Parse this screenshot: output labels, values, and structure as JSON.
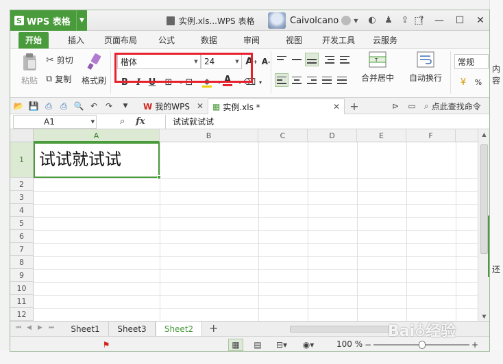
{
  "window": {
    "app_name": "WPS 表格",
    "title": "实例.xls...WPS 表格",
    "user_name": "Caivolcano"
  },
  "menu": {
    "tabs": [
      "开始",
      "插入",
      "页面布局",
      "公式",
      "数据",
      "审阅",
      "视图",
      "开发工具",
      "云服务"
    ],
    "active": "开始"
  },
  "ribbon": {
    "paste": "粘贴",
    "cut": "剪切",
    "copy": "复制",
    "format_painter": "格式刷",
    "font_name": "楷体",
    "font_size": "24",
    "merge_center": "合并居中",
    "wrap_text": "自动换行",
    "number_format": "常规"
  },
  "quickbar": {
    "tab_home": "我的WPS",
    "tab_doc": "实例.xls *",
    "find_command": "点此查找命令"
  },
  "formula_bar": {
    "name_box": "A1",
    "fx": "fx",
    "content": "试试就试试"
  },
  "grid": {
    "columns": [
      "A",
      "B",
      "C",
      "D",
      "E",
      "F"
    ],
    "rows": [
      "1",
      "2",
      "3",
      "4",
      "5",
      "6",
      "7",
      "8",
      "9",
      "10",
      "11",
      "12"
    ],
    "cell_A1": "试试就试试"
  },
  "sheets": {
    "tabs": [
      "Sheet1",
      "Sheet3",
      "Sheet2"
    ],
    "active": "Sheet2"
  },
  "status": {
    "zoom": "100 %"
  },
  "background": {
    "right_text_1": "内容",
    "right_text_2": "还"
  },
  "colors": {
    "accent": "#4a9b3c",
    "highlight_box": "#e8202b",
    "font_color_red": "#e8202b",
    "fill_yellow": "#f0d000"
  }
}
